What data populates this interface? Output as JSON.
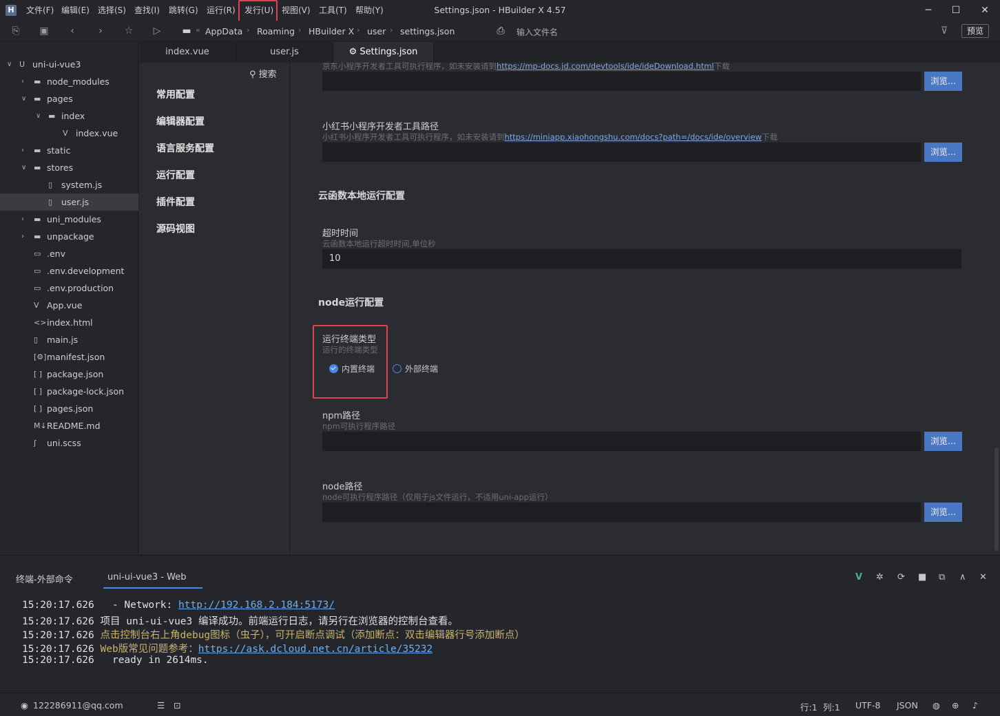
{
  "window": {
    "title": "Settings.json - HBuilder X 4.57",
    "app_icon": "H",
    "minimize_icon": "─",
    "maximize_icon": "☐",
    "close_icon": "✕"
  },
  "menu": [
    {
      "label": "文件(F)"
    },
    {
      "label": "编辑(E)"
    },
    {
      "label": "选择(S)"
    },
    {
      "label": "查找(I)"
    },
    {
      "label": "跳转(G)"
    },
    {
      "label": "运行(R)"
    },
    {
      "label": "发行(U)"
    },
    {
      "label": "视图(V)"
    },
    {
      "label": "工具(T)"
    },
    {
      "label": "帮助(Y)"
    }
  ],
  "toolbar": {
    "breadcrumb": [
      "AppData",
      "Roaming",
      "HBuilder X",
      "user",
      "settings.json"
    ],
    "file_search_placeholder": "输入文件名",
    "preview_label": "预览"
  },
  "sidebar": {
    "items": [
      {
        "label": "uni-ui-vue3",
        "arrow": "∨",
        "icon": "U"
      },
      {
        "label": "node_modules",
        "arrow": "›",
        "icon": "▬"
      },
      {
        "label": "pages",
        "arrow": "∨",
        "icon": "▬"
      },
      {
        "label": "index",
        "arrow": "∨",
        "icon": "▬"
      },
      {
        "label": "index.vue",
        "arrow": "",
        "icon": "V"
      },
      {
        "label": "static",
        "arrow": "›",
        "icon": "▬"
      },
      {
        "label": "stores",
        "arrow": "∨",
        "icon": "▬"
      },
      {
        "label": "system.js",
        "arrow": "",
        "icon": "▯"
      },
      {
        "label": "user.js",
        "arrow": "",
        "icon": "▯"
      },
      {
        "label": "uni_modules",
        "arrow": "›",
        "icon": "▬"
      },
      {
        "label": "unpackage",
        "arrow": "›",
        "icon": "▬"
      },
      {
        "label": ".env",
        "arrow": "",
        "icon": "▭"
      },
      {
        "label": ".env.development",
        "arrow": "",
        "icon": "▭"
      },
      {
        "label": ".env.production",
        "arrow": "",
        "icon": "▭"
      },
      {
        "label": "App.vue",
        "arrow": "",
        "icon": "V"
      },
      {
        "label": "index.html",
        "arrow": "",
        "icon": "<>"
      },
      {
        "label": "main.js",
        "arrow": "",
        "icon": "▯"
      },
      {
        "label": "manifest.json",
        "arrow": "",
        "icon": "[⚙]"
      },
      {
        "label": "package.json",
        "arrow": "",
        "icon": "[ ]"
      },
      {
        "label": "package-lock.json",
        "arrow": "",
        "icon": "[ ]"
      },
      {
        "label": "pages.json",
        "arrow": "",
        "icon": "[ ]"
      },
      {
        "label": "README.md",
        "arrow": "",
        "icon": "M↓"
      },
      {
        "label": "uni.scss",
        "arrow": "",
        "icon": "ʃ"
      }
    ]
  },
  "tabs": [
    {
      "label": "index.vue"
    },
    {
      "label": "user.js"
    },
    {
      "label": "⚙ Settings.json"
    }
  ],
  "settings_nav": {
    "search_label": "搜索",
    "items": [
      "常用配置",
      "编辑器配置",
      "语言服务配置",
      "运行配置",
      "插件配置",
      "源码视图"
    ]
  },
  "settings": {
    "jd_desc_prefix": "京东小程序开发者工具可执行程序，如未安装请到",
    "jd_link": "https://mp-docs.jd.com/devtools/ide/ideDownload.html",
    "jd_desc_suffix": "下载",
    "browse_label": "浏览...",
    "xhs_title": "小红书小程序开发者工具路径",
    "xhs_desc_prefix": "小红书小程序开发者工具可执行程序，如未安装请到",
    "xhs_link": "https://miniapp.xiaohongshu.com/docs?path=/docs/ide/overview",
    "xhs_desc_suffix": "下载",
    "cloud_section": "云函数本地运行配置",
    "timeout_title": "超时时间",
    "timeout_desc": "云函数本地运行超时时间,单位秒",
    "timeout_value": "10",
    "node_section": "node运行配置",
    "terminal_title": "运行终端类型",
    "terminal_desc": "运行的终端类型",
    "terminal_options": [
      "内置终端",
      "外部终端"
    ],
    "terminal_selected": "内置终端",
    "npm_title": "npm路径",
    "npm_desc": "npm可执行程序路径",
    "node_title": "node路径",
    "node_desc": "node可执行程序路径（仅用于js文件运行，不适用uni-app运行）"
  },
  "bottom_panel": {
    "tabs": [
      "终端-外部命令",
      "uni-ui-vue3 - Web"
    ],
    "active_tab": "uni-ui-vue3 - Web",
    "logs": [
      {
        "time": "15:20:17.626",
        "text": "  - Network: ",
        "url": "http://192.168.2.184:5173/"
      },
      {
        "time": "15:20:17.626",
        "text": "项目 uni-ui-vue3 编译成功。前端运行日志，请另行在浏览器的控制台查看。"
      },
      {
        "time": "15:20:17.626",
        "yellow": "点击控制台右上角debug图标（虫子），可开启断点调试（添加断点：双击编辑器行号添加断点）"
      },
      {
        "time": "15:20:17.626",
        "yellow": "Web版常见问题参考：",
        "url": "https://ask.dcloud.net.cn/article/35232"
      },
      {
        "time": "15:20:17.626",
        "text": "  ready in 2614ms."
      }
    ],
    "accent_color": "#42b883"
  },
  "statusbar": {
    "account": "122286911@qq.com",
    "line_label": "行:1",
    "col_label": "列:1",
    "encoding": "UTF-8",
    "language": "JSON"
  },
  "colors": {
    "highlight_box": "#e2434f",
    "accent": "#4a86e8",
    "browse_button": "#4a77c4"
  }
}
